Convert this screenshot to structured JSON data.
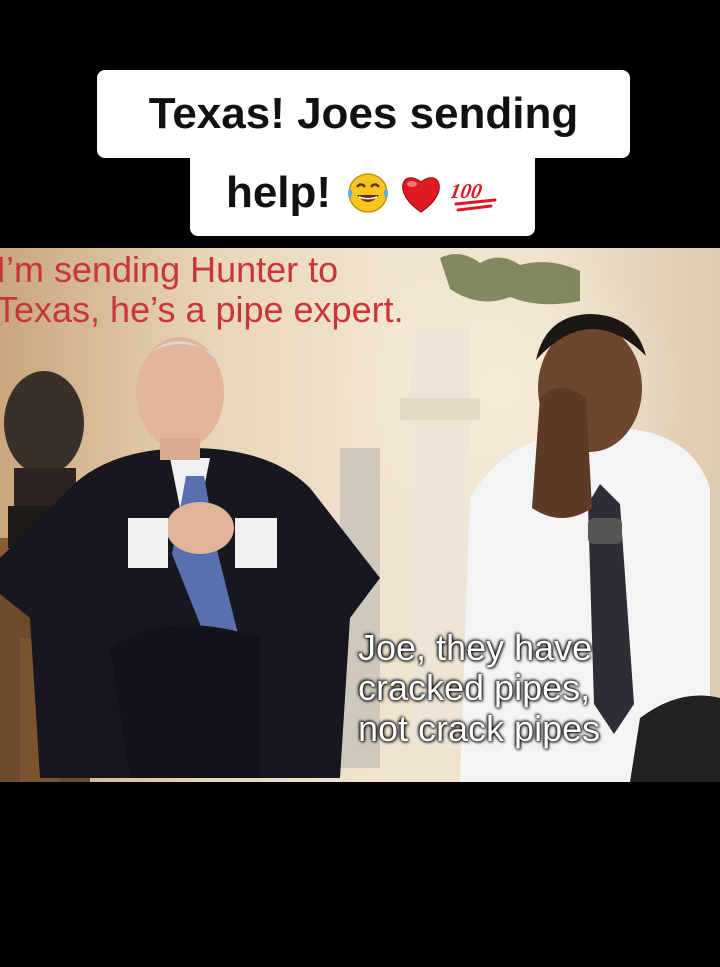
{
  "caption": {
    "line1": "Texas! Joes sending",
    "line2": "help!",
    "emojis": [
      "laughing-tears-emoji",
      "red-heart-emoji",
      "hundred-points-emoji"
    ],
    "hundred_label": "100"
  },
  "meme": {
    "top_text": [
      "I’m sending Hunter to",
      "Texas, he’s a pipe expert."
    ],
    "bottom_text": [
      "Joe, they have",
      "cracked pipes,",
      "not crack pipes"
    ]
  },
  "colors": {
    "background": "#000000",
    "caption_bg": "#ffffff",
    "top_text": "#c8363a",
    "bottom_text": "#ffffff"
  }
}
